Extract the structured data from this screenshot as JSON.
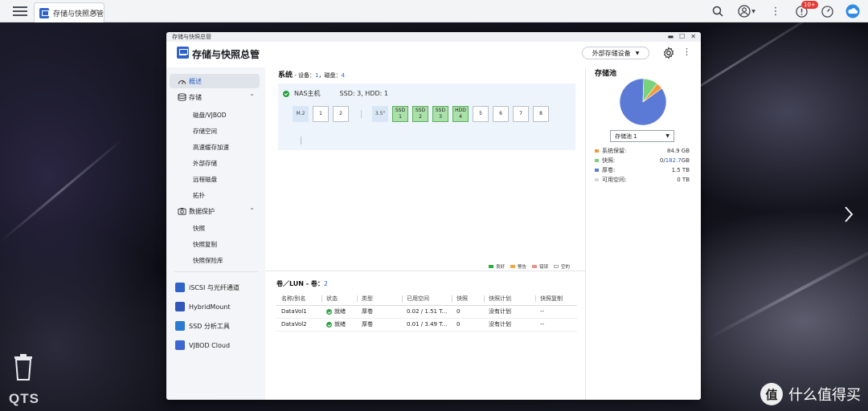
{
  "topbar": {
    "tab_label": "存储与快照总管",
    "notification_count": "10+"
  },
  "window": {
    "title_small": "存储与快照总管",
    "app_title": "存储与快照总管",
    "external_storage_button": "外部存储设备"
  },
  "sidebar": {
    "overview": "概述",
    "storage": "存储",
    "storage_items": [
      "磁盘/VJBOD",
      "存储空间",
      "高速缓存加速",
      "外部存储",
      "远程磁盘",
      "拓扑"
    ],
    "data_protection": "数据保护",
    "protection_items": [
      "快照",
      "快照复制",
      "快照保险库"
    ],
    "apps": [
      "iSCSI 与光纤通道",
      "HybridMount",
      "SSD 分析工具",
      "VJBOD Cloud"
    ]
  },
  "system": {
    "title": "系统",
    "devices_label": " - 设备：",
    "devices": "1",
    "disks_label": "，磁盘：",
    "disks": "4",
    "nas_name": "NAS主机",
    "summary": "SSD: 3, HDD: 1",
    "m2_label": "M.2",
    "m2_slots": [
      "1",
      "2"
    ],
    "bay_label": "3.5\"",
    "bays": [
      {
        "type": "SSD",
        "num": "1"
      },
      {
        "type": "SSD",
        "num": "2"
      },
      {
        "type": "SSD",
        "num": "3"
      },
      {
        "type": "HDD",
        "num": "4"
      },
      {
        "type": "",
        "num": "5"
      },
      {
        "type": "",
        "num": "6"
      },
      {
        "type": "",
        "num": "7"
      },
      {
        "type": "",
        "num": "8"
      }
    ],
    "legend": [
      {
        "label": "良好",
        "color": "#2cae3d"
      },
      {
        "label": "警告",
        "color": "#f3a540"
      },
      {
        "label": "错误",
        "color": "#e8908a"
      },
      {
        "label": "空的",
        "color": "#ffffff"
      }
    ]
  },
  "volumes": {
    "title": "卷／LUN - 卷：",
    "count": "2",
    "columns": [
      "名称/别名",
      "状态",
      "类型",
      "已用空间",
      "快照",
      "快照计划",
      "快照复制"
    ],
    "rows": [
      {
        "name": "DataVol1",
        "status": "就绪",
        "type": "厚卷",
        "used": "0.02 / 1.51 T...",
        "snapshots": "0",
        "schedule": "没有计划",
        "replication": "--"
      },
      {
        "name": "DataVol2",
        "status": "就绪",
        "type": "厚卷",
        "used": "0.01 / 3.49 T...",
        "snapshots": "0",
        "schedule": "没有计划",
        "replication": "--"
      }
    ]
  },
  "pool": {
    "title": "存储池",
    "selected": "存储池 1",
    "stats": [
      {
        "label": "系统保留:",
        "value": "84.9 GB",
        "color": "#f39a3a"
      },
      {
        "label": "快照:",
        "value_prefix": "0/",
        "value_link": "182.7",
        "value_suffix": "GB",
        "color": "#79d27c"
      },
      {
        "label": "厚卷:",
        "value": "1.5 TB",
        "color": "#5b7ad6"
      },
      {
        "label": "可用空间:",
        "value": "0 TB",
        "color": "#d9d9d9"
      }
    ],
    "pie": [
      {
        "name": "厚卷",
        "fraction": 0.855,
        "color": "#5b7ad6"
      },
      {
        "name": "快照",
        "fraction": 0.1,
        "color": "#79d27c"
      },
      {
        "name": "系统保留",
        "fraction": 0.045,
        "color": "#f39a3a"
      }
    ]
  },
  "watermark": {
    "logo": "值",
    "text": "什么值得买"
  },
  "desktop": {
    "brand": "QTS"
  }
}
